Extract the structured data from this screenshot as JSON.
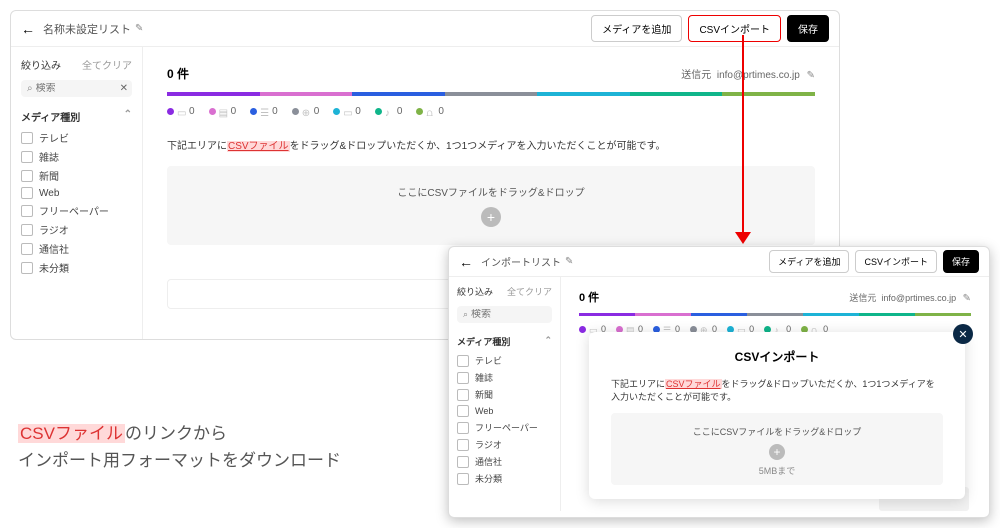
{
  "colors": [
    "#8a2be2",
    "#d96fd0",
    "#2a5fe0",
    "#8a8f99",
    "#1db3d6",
    "#0fb58a",
    "#7fb347"
  ],
  "header": {
    "title": "名称未設定リスト",
    "add_media": "メディアを追加",
    "csv_import": "CSVインポート",
    "save": "保存"
  },
  "sidebar": {
    "filter_label": "絞り込み",
    "clear_all": "全てクリア",
    "search_placeholder": "検索",
    "category_header": "メディア種別",
    "categories": [
      "テレビ",
      "雑誌",
      "新聞",
      "Web",
      "フリーペーパー",
      "ラジオ",
      "通信社",
      "未分類"
    ]
  },
  "main": {
    "count": "0 件",
    "sender_label": "送信元",
    "sender_value": "info@prtimes.co.jp",
    "legend_icons": [
      "monitor",
      "book",
      "newspaper",
      "globe",
      "paper",
      "radio",
      "antenna"
    ],
    "legend_counts": [
      0,
      0,
      0,
      0,
      0,
      0,
      0
    ],
    "instr_pre": "下記エリアに",
    "instr_link": "CSVファイル",
    "instr_post": "をドラッグ&ドロップいただくか、1つ1つメディアを入力いただくことが可能です。",
    "drop_text": "ここにCSVファイルをドラッグ&ドロップ"
  },
  "panel2": {
    "title": "インポートリスト",
    "modal_title": "CSVインポート",
    "modal_instr_post": "をドラッグ&ドロップいただくか、1つ1つメディアを入力いただくことが可能です。",
    "limit": "5MBまで"
  },
  "caption": {
    "hl": "CSVファイル",
    "l1": "のリンクから",
    "l2": "インポート用フォーマットをダウンロード"
  }
}
